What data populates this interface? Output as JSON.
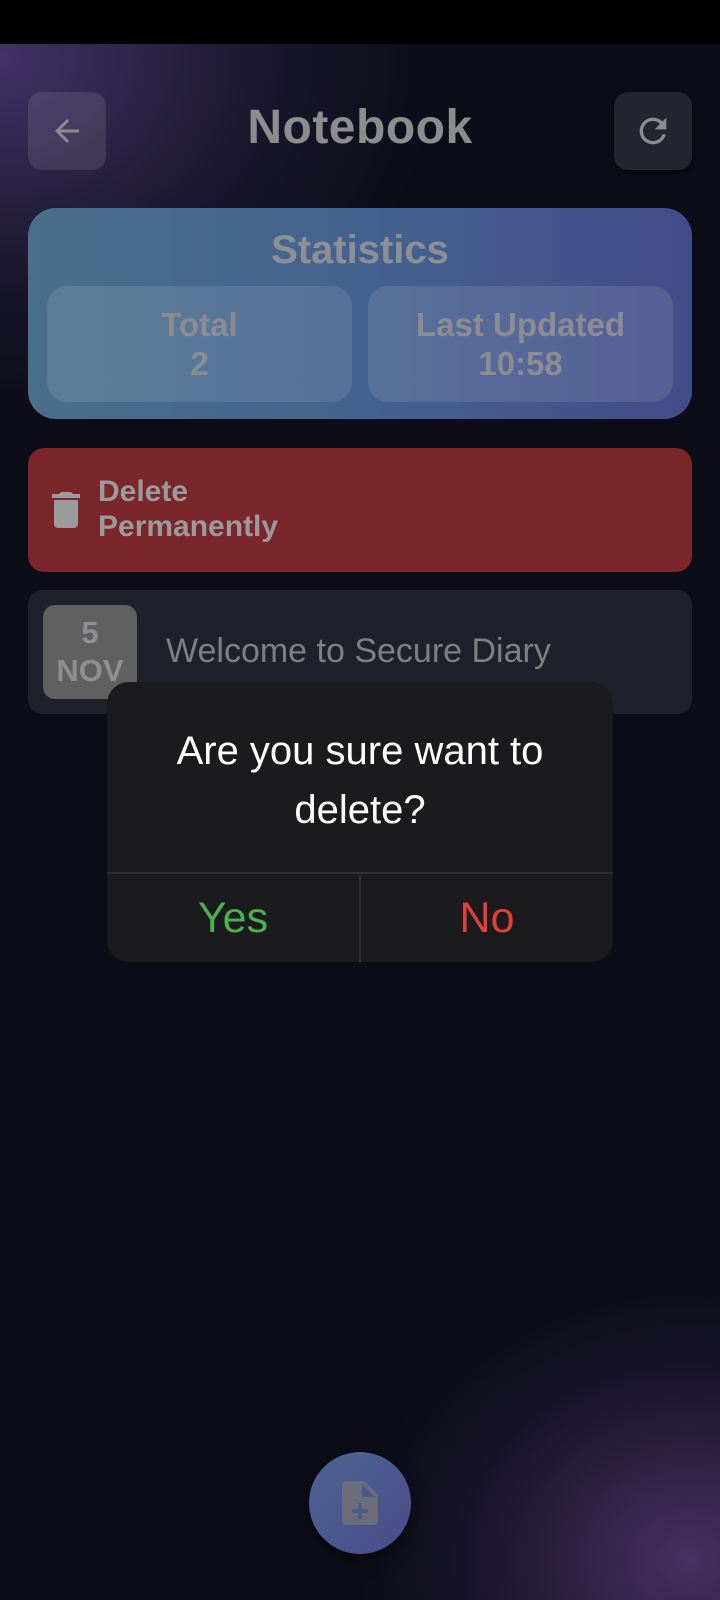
{
  "header": {
    "title": "Notebook",
    "back_icon": "arrow-left-icon",
    "refresh_icon": "refresh-icon"
  },
  "statistics": {
    "title": "Statistics",
    "total_label": "Total",
    "total_value": "2",
    "updated_label": "Last Updated",
    "updated_value": "10:58"
  },
  "delete_button": {
    "label_line1": "Delete",
    "label_line2": "Permanently",
    "icon": "trash-icon"
  },
  "entries": [
    {
      "day": "5",
      "month": "NOV",
      "title": "Welcome to Secure Diary"
    }
  ],
  "dialog": {
    "message": "Are you sure want to delete?",
    "yes_label": "Yes",
    "no_label": "No"
  },
  "fab": {
    "icon": "add-note-icon"
  },
  "colors": {
    "yes": "#4caf50",
    "no": "#e0403a",
    "delete_bg": "#7a262a"
  }
}
